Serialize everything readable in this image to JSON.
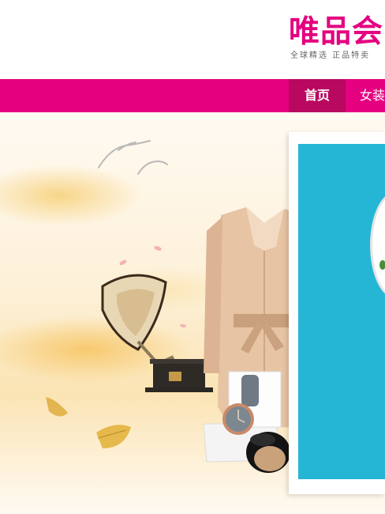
{
  "header": {
    "logo_text": "唯品会",
    "logo_slogan": "全球精选 正品特卖"
  },
  "nav": {
    "items": [
      {
        "label": "首页",
        "active": true
      },
      {
        "label": "女装",
        "active": false
      }
    ]
  },
  "colors": {
    "brand": "#e4007f",
    "nav_active": "#b8085f",
    "card_bg": "#25b6d6"
  },
  "icons": [
    "birds-icon",
    "gramophone-icon",
    "trench-coat-icon",
    "watch-icon",
    "cushion-compact-icon",
    "gold-leaf-icon"
  ]
}
